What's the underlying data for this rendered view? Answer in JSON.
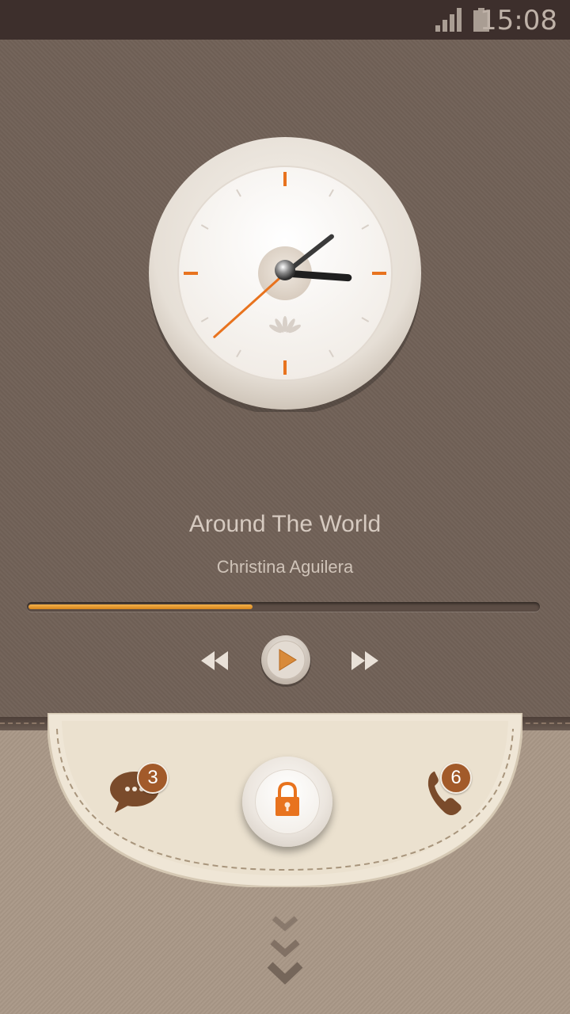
{
  "status_bar": {
    "time": "15:08",
    "signal_icon": "signal-icon",
    "battery_icon": "battery-icon"
  },
  "clock": {
    "hour": 15,
    "minute": 8,
    "second": 38,
    "logo": "huawei-logo"
  },
  "music": {
    "title": "Around The World",
    "artist": "Christina Aguilera",
    "progress_percent": 44,
    "controls": [
      "rewind-icon",
      "play-icon",
      "fast-forward-icon"
    ]
  },
  "notifications": {
    "messages_count": "3",
    "missed_calls_count": "6"
  },
  "unlock": {
    "icon": "lock-icon",
    "hint_icon": "chevron-down-icon"
  },
  "colors": {
    "accent": "#e8731e",
    "badge": "#a25a2a",
    "top_bg": "#716157",
    "bottom_bg": "#a99887"
  }
}
